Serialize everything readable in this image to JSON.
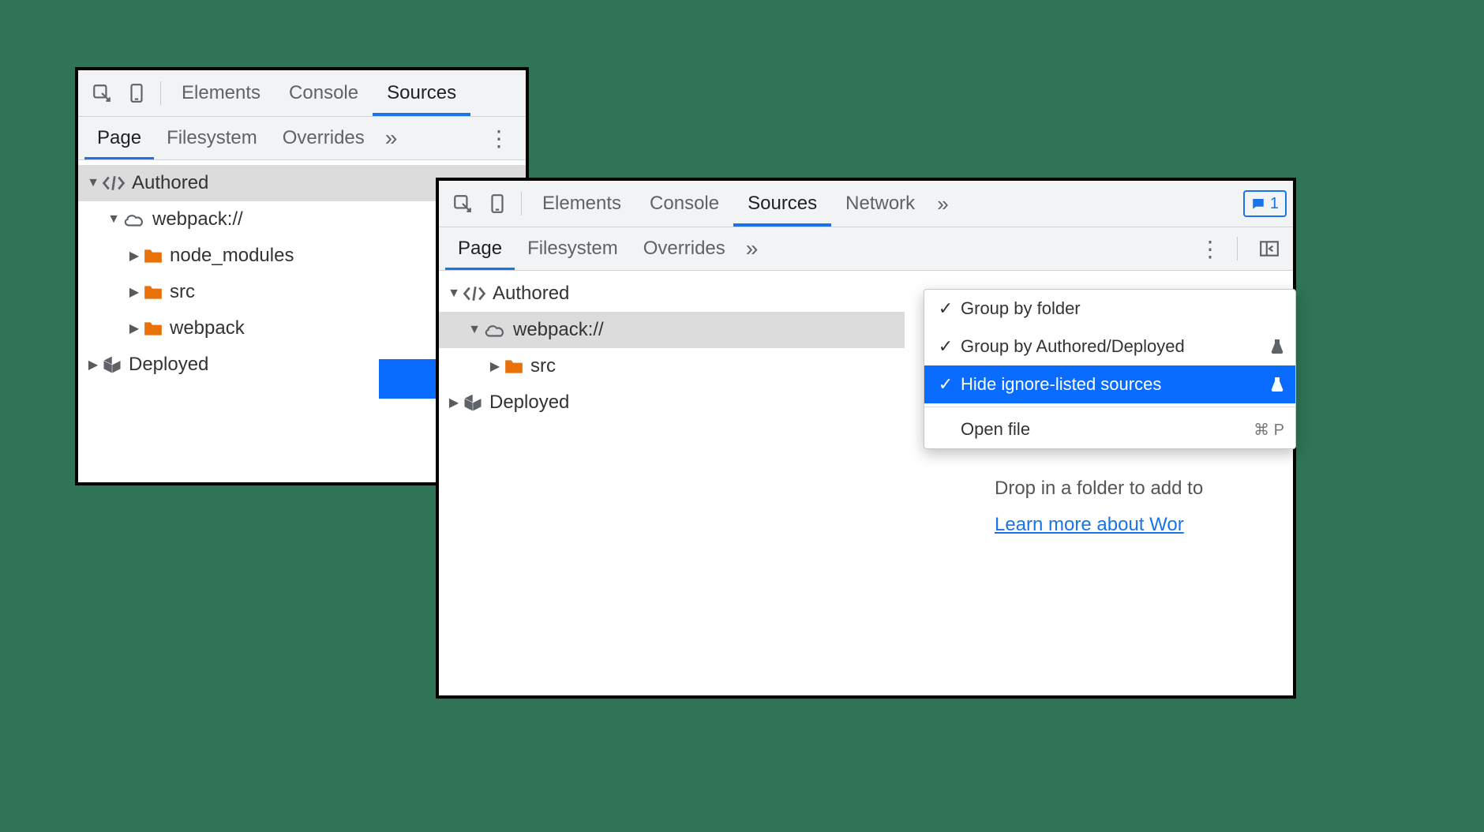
{
  "arrow_color": "#0a6cff",
  "left_panel": {
    "top_tabs": [
      "Elements",
      "Console",
      "Sources"
    ],
    "top_active": "Sources",
    "sub_tabs": [
      "Page",
      "Filesystem",
      "Overrides"
    ],
    "sub_active": "Page",
    "tree": {
      "authored": "Authored",
      "webpack": "webpack://",
      "node_modules": "node_modules",
      "src": "src",
      "webpack_folder": "webpack",
      "deployed": "Deployed"
    }
  },
  "right_panel": {
    "top_tabs": [
      "Elements",
      "Console",
      "Sources",
      "Network"
    ],
    "top_active": "Sources",
    "badge_count": "1",
    "sub_tabs": [
      "Page",
      "Filesystem",
      "Overrides"
    ],
    "sub_active": "Page",
    "tree": {
      "authored": "Authored",
      "webpack": "webpack://",
      "src": "src",
      "deployed": "Deployed"
    },
    "info_text": "Drop in a folder to add to",
    "learn_more": "Learn more about Wor"
  },
  "menu": {
    "items": [
      {
        "label": "Group by folder",
        "checked": true,
        "flask": false
      },
      {
        "label": "Group by Authored/Deployed",
        "checked": true,
        "flask": true
      },
      {
        "label": "Hide ignore-listed sources",
        "checked": true,
        "flask": true,
        "highlight": true
      }
    ],
    "open_file": "Open file",
    "open_file_shortcut": "⌘ P"
  }
}
